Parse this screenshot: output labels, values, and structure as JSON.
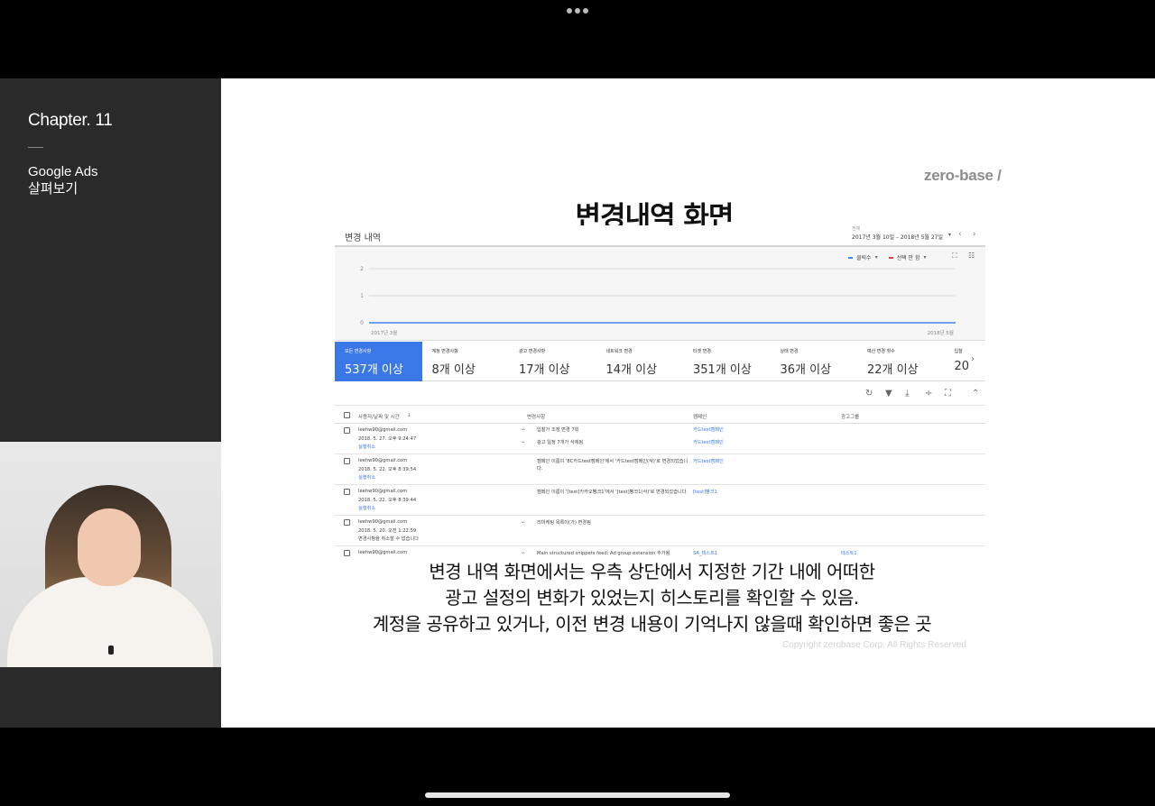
{
  "sidebar": {
    "chapter": "Chapter. 11",
    "course_line1": "Google Ads",
    "course_line2": "살펴보기"
  },
  "slide": {
    "brand": "zero-base /",
    "title": "변경내역 화면",
    "caption_lines": [
      "변경 내역 화면에서는 우측 상단에서 지정한 기간 내에 어떠한",
      "광고 설정의 변화가 있었는지 히스토리를 확인할 수 있음.",
      "계정을 공유하고 있거나, 이전 변경 내용이 기억나지 않을때 확인하면 좋은 곳"
    ],
    "copyright": "Copyright zerobase Corp. All Rights Reserved"
  },
  "screenshot": {
    "header_title": "변경 내역",
    "range_label": "전체",
    "range_value": "2017년 3월 10일 – 2018년 5월 27일",
    "legend": [
      {
        "label": "클릭수",
        "color": "#4285f4"
      },
      {
        "label": "선택 안 함",
        "color": "#db4437"
      }
    ],
    "metrics": [
      {
        "label": "모든 변경사항",
        "value": "537개 이상"
      },
      {
        "label": "계정 변경사항",
        "value": "8개 이상"
      },
      {
        "label": "광고 변경사항",
        "value": "17개 이상"
      },
      {
        "label": "네트워크 변경",
        "value": "14개 이상"
      },
      {
        "label": "타겟 변경",
        "value": "351개 이상"
      },
      {
        "label": "상태 변경",
        "value": "36개 이상"
      },
      {
        "label": "예산 변경 횟수",
        "value": "22개 이상"
      },
      {
        "label": "입찰",
        "value": "20"
      }
    ],
    "table_headers": {
      "user": "사용자/날짜 및 시간",
      "change": "변경사항",
      "campaign": "캠페인",
      "adgroup": "광고그룹"
    },
    "rows": [
      {
        "email": "leehw90@gmail.com",
        "date": "2018. 5. 27. 오후 9:24:47",
        "undo": "실행취소",
        "changes": [
          "입찰가 조정 변경 7회",
          "광고 일정 7개가 삭제됨"
        ],
        "campaigns": [
          "카드test캠페인",
          "카드test캠페인"
        ],
        "adgroup": ""
      },
      {
        "email": "leehw90@gmail.com",
        "date": "2018. 5. 22. 오후 8:39:54",
        "undo": "실행취소",
        "changes": [
          "캠페인 이름이 '8C카드test캠페인'에서 '카드test캠페인(삭)'로 변경되었습니다."
        ],
        "campaigns": [
          "카드test캠페인"
        ],
        "adgroup": ""
      },
      {
        "email": "leehw90@gmail.com",
        "date": "2018. 5. 22. 오후 8:39:44",
        "undo": "실행취소",
        "changes": [
          "캠페인 이름이 '[test]카카오빵크1'에서 '[test]빵크1(삭)'로 변경되었습니다."
        ],
        "campaigns": [
          "[test]빵크1"
        ],
        "adgroup": ""
      },
      {
        "email": "leehw90@gmail.com",
        "date": "2018. 5. 20. 오전 1:22:59",
        "undo": "변경사항을 취소할 수 없습니다",
        "changes": [
          "리마케팅 목록이(가) 변경됨"
        ],
        "campaigns": [],
        "adgroup": ""
      },
      {
        "email": "leehw90@gmail.com",
        "date": "",
        "undo": "",
        "changes": [
          "Main structured snippets feed: Ad group extension 추가됨"
        ],
        "campaigns": [
          "SA_테스트1"
        ],
        "adgroup": "테스트1"
      }
    ]
  },
  "chart_data": {
    "type": "line",
    "x": [
      "2017년 3월",
      "2018년 5월"
    ],
    "y_ticks": [
      0,
      1,
      2
    ],
    "ylim": [
      0,
      2
    ],
    "series": [
      {
        "name": "클릭수",
        "values": [
          0,
          0
        ],
        "color": "#4285f4"
      }
    ],
    "xlabel": "",
    "ylabel": "",
    "title": "",
    "grid": true
  }
}
